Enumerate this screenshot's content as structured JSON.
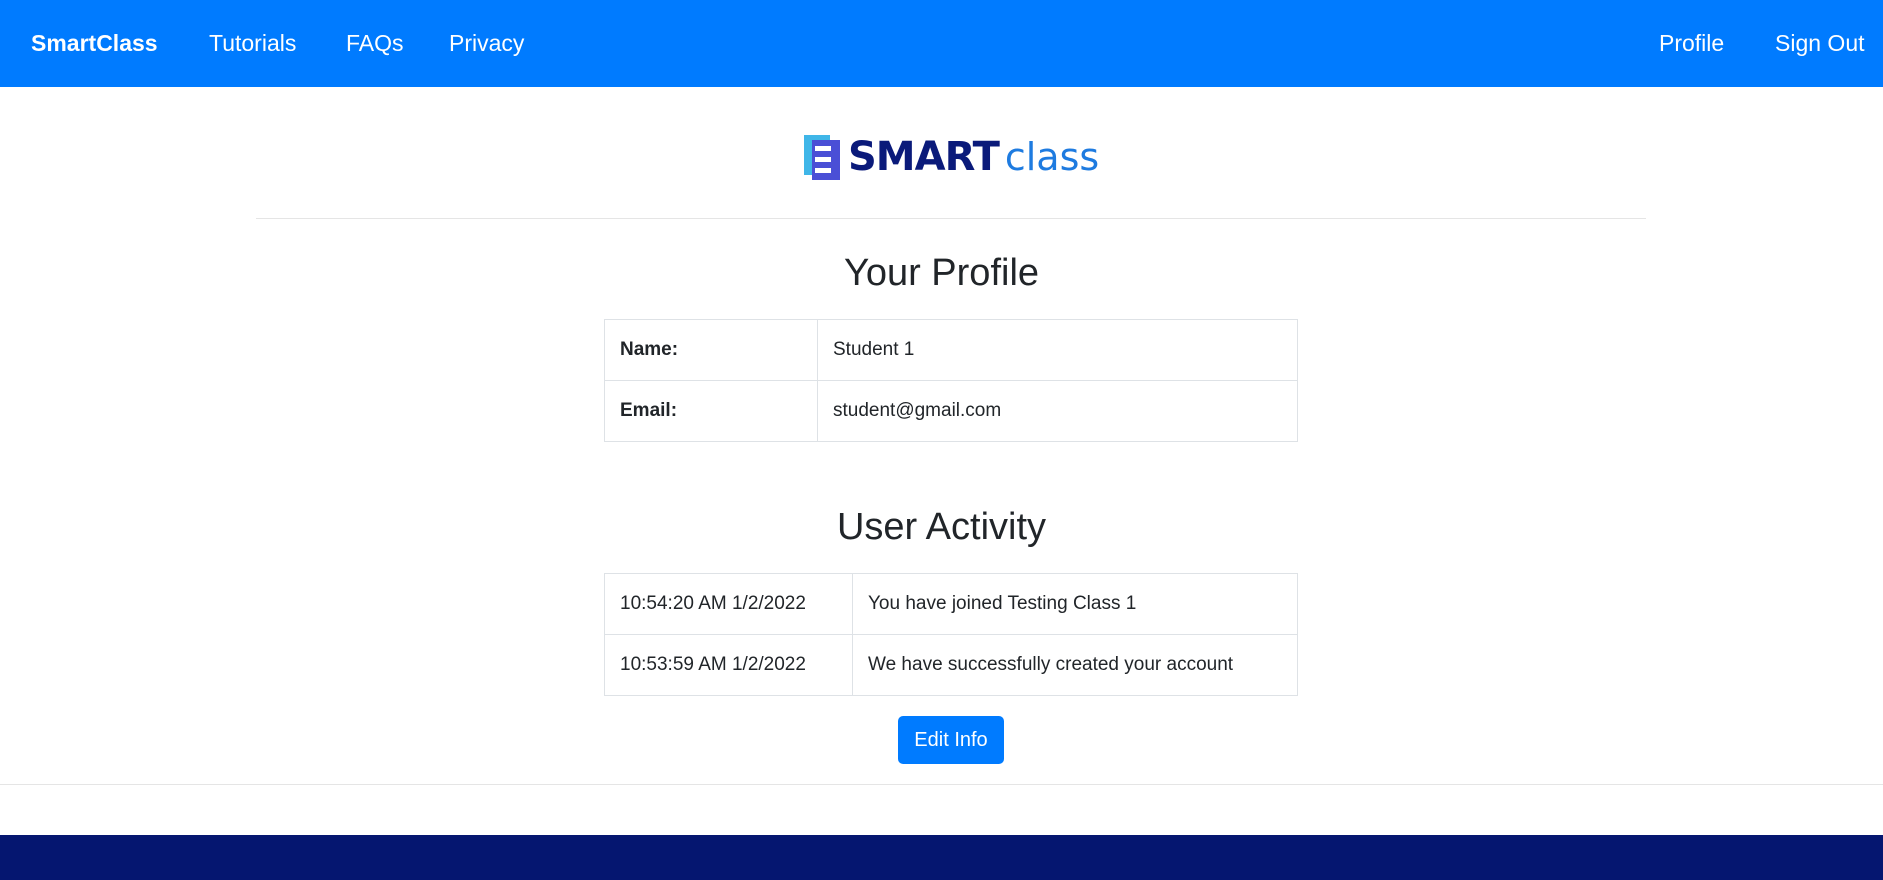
{
  "nav": {
    "brand": "SmartClass",
    "links": [
      "Tutorials",
      "FAQs",
      "Privacy"
    ],
    "right_links": [
      "Profile",
      "Sign Out"
    ]
  },
  "logo": {
    "text_bold": "SMART",
    "text_light": "class"
  },
  "profile": {
    "title": "Your Profile",
    "rows": [
      {
        "label": "Name:",
        "value": "Student 1"
      },
      {
        "label": "Email:",
        "value": "student@gmail.com"
      }
    ]
  },
  "activity": {
    "title": "User Activity",
    "rows": [
      {
        "time": "10:54:20 AM 1/2/2022",
        "message": "You have joined Testing Class 1"
      },
      {
        "time": "10:53:59 AM 1/2/2022",
        "message": "We have successfully created your account"
      }
    ]
  },
  "actions": {
    "edit_label": "Edit Info"
  },
  "colors": {
    "primary": "#007bff",
    "footer": "#051670",
    "logo_dark": "#0a1a7a",
    "logo_light": "#1e7be0"
  }
}
